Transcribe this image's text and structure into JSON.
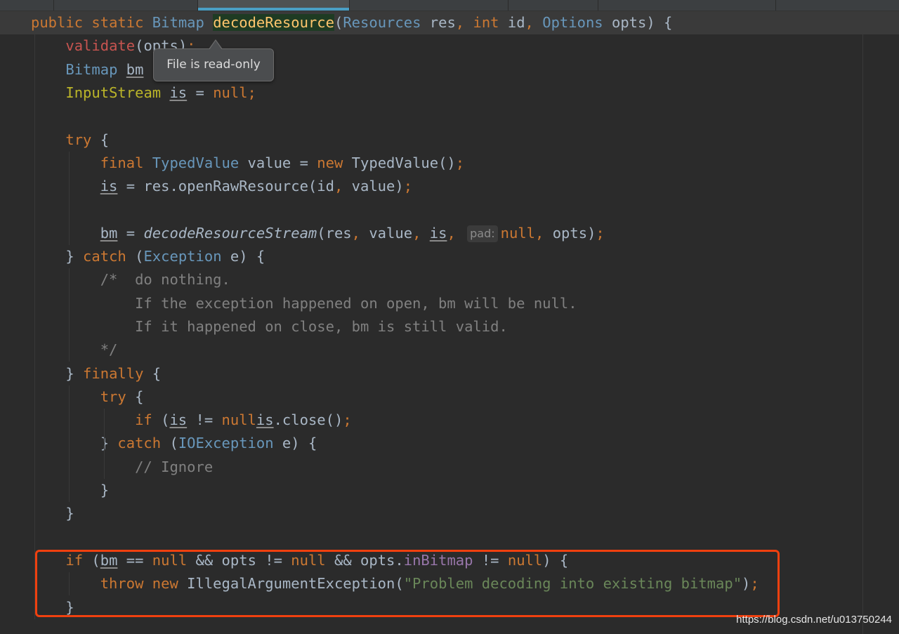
{
  "tooltip": "File is read-only",
  "watermark": "https://blog.csdn.net/u013750244",
  "colors": {
    "keyword": "#cc7832",
    "type": "#6897bb",
    "method": "#ffc66d",
    "comment": "#808080",
    "string": "#6a8759",
    "field": "#9876aa",
    "highlight_box": "#f0400f"
  },
  "code_lines": [
    {
      "indent": 0,
      "tokens": [
        [
          "k",
          "public static "
        ],
        [
          "t",
          "Bitmap "
        ],
        [
          "fh",
          "decodeResource"
        ],
        [
          "",
          "("
        ],
        [
          "t",
          "Resources "
        ],
        [
          "",
          "res"
        ],
        [
          "k",
          ", int "
        ],
        [
          "",
          "id"
        ],
        [
          "k",
          ", "
        ],
        [
          "t",
          "Options "
        ],
        [
          "",
          "opts) {"
        ]
      ]
    },
    {
      "indent": 1,
      "tokens": [
        [
          "r",
          "validate"
        ],
        [
          "",
          "(opts)"
        ],
        [
          "k",
          ";"
        ]
      ]
    },
    {
      "indent": 1,
      "tokens": [
        [
          "t",
          "Bitmap "
        ],
        [
          "u",
          "bm"
        ]
      ]
    },
    {
      "indent": 1,
      "tokens": [
        [
          "y",
          "InputStream "
        ],
        [
          "u",
          "is"
        ],
        [
          "",
          " = "
        ],
        [
          "k",
          "null;"
        ]
      ]
    },
    {
      "indent": 0,
      "tokens": []
    },
    {
      "indent": 1,
      "tokens": [
        [
          "k",
          "try "
        ],
        [
          "",
          "{"
        ]
      ]
    },
    {
      "indent": 2,
      "tokens": [
        [
          "k",
          "final "
        ],
        [
          "t",
          "TypedValue "
        ],
        [
          "",
          "value = "
        ],
        [
          "k",
          "new "
        ],
        [
          "",
          "TypedValue()"
        ],
        [
          "k",
          ";"
        ]
      ]
    },
    {
      "indent": 2,
      "tokens": [
        [
          "u",
          "is"
        ],
        [
          "",
          " = res.openRawResource(id"
        ],
        [
          "k",
          ", "
        ],
        [
          "",
          "value)"
        ],
        [
          "k",
          ";"
        ]
      ]
    },
    {
      "indent": 0,
      "tokens": []
    },
    {
      "indent": 2,
      "tokens": [
        [
          "u",
          "bm"
        ],
        [
          "",
          " = "
        ],
        [
          "i",
          "decodeResourceStream"
        ],
        [
          "",
          "(res"
        ],
        [
          "k",
          ", "
        ],
        [
          "",
          "value"
        ],
        [
          "k",
          ", "
        ],
        [
          "u",
          "is"
        ],
        [
          "k",
          ", "
        ],
        [
          "hint",
          "pad:"
        ],
        [
          "k",
          "null, "
        ],
        [
          "",
          "opts)"
        ],
        [
          "k",
          ";"
        ]
      ]
    },
    {
      "indent": 1,
      "tokens": [
        [
          "",
          "} "
        ],
        [
          "k",
          "catch "
        ],
        [
          "",
          "("
        ],
        [
          "t",
          "Exception "
        ],
        [
          "",
          "e) {"
        ]
      ]
    },
    {
      "indent": 2,
      "tokens": [
        [
          "c",
          "/*  do nothing."
        ]
      ]
    },
    {
      "indent": 2,
      "tokens": [
        [
          "c",
          "    If the exception happened on open, bm will be null."
        ]
      ]
    },
    {
      "indent": 2,
      "tokens": [
        [
          "c",
          "    If it happened on close, bm is still valid."
        ]
      ]
    },
    {
      "indent": 2,
      "tokens": [
        [
          "c",
          "*/"
        ]
      ]
    },
    {
      "indent": 1,
      "tokens": [
        [
          "",
          "} "
        ],
        [
          "k",
          "finally "
        ],
        [
          "",
          "{"
        ]
      ]
    },
    {
      "indent": 2,
      "tokens": [
        [
          "k",
          "try "
        ],
        [
          "",
          "{"
        ]
      ]
    },
    {
      "indent": 3,
      "tokens": [
        [
          "k",
          "if "
        ],
        [
          "",
          "("
        ],
        [
          "u",
          "is"
        ],
        [
          "",
          " != "
        ],
        [
          "k",
          "null"
        ],
        [
          ") "
        ],
        [
          "u",
          "is"
        ],
        [
          "",
          ".close()"
        ],
        [
          "k",
          ";"
        ]
      ]
    },
    {
      "indent": 2,
      "tokens": [
        [
          "",
          "} "
        ],
        [
          "k",
          "catch "
        ],
        [
          "",
          "("
        ],
        [
          "t",
          "IOException "
        ],
        [
          "",
          "e) {"
        ]
      ]
    },
    {
      "indent": 3,
      "tokens": [
        [
          "c",
          "// Ignore"
        ]
      ]
    },
    {
      "indent": 2,
      "tokens": [
        [
          "",
          "}"
        ]
      ]
    },
    {
      "indent": 1,
      "tokens": [
        [
          "",
          "}"
        ]
      ]
    },
    {
      "indent": 0,
      "tokens": []
    },
    {
      "indent": 1,
      "tokens": [
        [
          "k",
          "if "
        ],
        [
          "",
          "("
        ],
        [
          "u",
          "bm"
        ],
        [
          "",
          " == "
        ],
        [
          "k",
          "null "
        ],
        [
          "",
          "&& opts != "
        ],
        [
          "k",
          "null "
        ],
        [
          "",
          "&& opts."
        ],
        [
          "p",
          "inBitmap"
        ],
        [
          "",
          " != "
        ],
        [
          "k",
          "null"
        ],
        [
          "",
          ") {"
        ]
      ]
    },
    {
      "indent": 2,
      "tokens": [
        [
          "k",
          "throw new "
        ],
        [
          "",
          "IllegalArgumentException("
        ],
        [
          "s",
          "\"Problem decoding into existing bitmap\""
        ],
        [
          "",
          ")"
        ],
        [
          "k",
          ";"
        ]
      ]
    },
    {
      "indent": 1,
      "tokens": [
        [
          "",
          "}"
        ]
      ]
    }
  ]
}
